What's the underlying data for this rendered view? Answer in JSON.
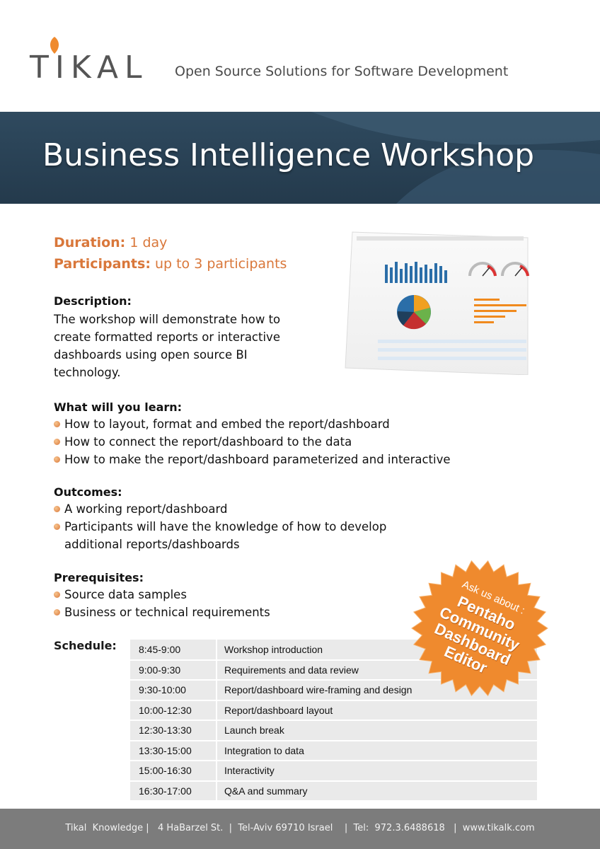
{
  "header": {
    "logo_text": "TIKAL",
    "tagline": "Open Source Solutions for Software Development"
  },
  "banner": {
    "title": "Business Intelligence Workshop"
  },
  "meta": {
    "duration_label": "Duration:",
    "duration_value": "1 day",
    "participants_label": "Participants:",
    "participants_value": "up to 3 participants"
  },
  "description": {
    "heading": "Description:",
    "text": "The workshop will demonstrate how to create formatted reports or interactive dashboards using open source BI technology."
  },
  "learn": {
    "heading": "What will you learn:",
    "items": [
      "How to layout, format and embed the report/dashboard",
      "How to connect the report/dashboard to the data",
      "How to make the report/dashboard parameterized and interactive"
    ]
  },
  "outcomes": {
    "heading": "Outcomes:",
    "items": [
      "A working report/dashboard",
      "Participants will have the knowledge of how to develop additional reports/dashboards"
    ]
  },
  "prereq": {
    "heading": "Prerequisites:",
    "items": [
      "Source data samples",
      "Business or technical requirements"
    ]
  },
  "schedule": {
    "heading": "Schedule:",
    "rows": [
      {
        "time": "8:45-9:00",
        "activity": "Workshop introduction"
      },
      {
        "time": "9:00-9:30",
        "activity": "Requirements and data review"
      },
      {
        "time": "9:30-10:00",
        "activity": "Report/dashboard wire-framing and design"
      },
      {
        "time": "10:00-12:30",
        "activity": "Report/dashboard layout"
      },
      {
        "time": "12:30-13:30",
        "activity": "Launch break"
      },
      {
        "time": "13:30-15:00",
        "activity": "Integration to data"
      },
      {
        "time": "15:00-16:30",
        "activity": "Interactivity"
      },
      {
        "time": "16:30-17:00",
        "activity": "Q&A and summary"
      }
    ]
  },
  "badge": {
    "ask": "Ask us about :",
    "lines": [
      "Pentaho",
      "Community",
      "Dashboard",
      "Editor"
    ]
  },
  "footer": {
    "text": "Tikal  Knowledge |   4 HaBarzel St.  |  Tel-Aviv 69710 Israel    |  Tel:  972.3.6488618   |  www.tikalk.com"
  },
  "colors": {
    "accent": "#d9773a",
    "banner": "#2f4a5f",
    "footer": "#7c7c7c",
    "badge": "#ef8a2e"
  }
}
